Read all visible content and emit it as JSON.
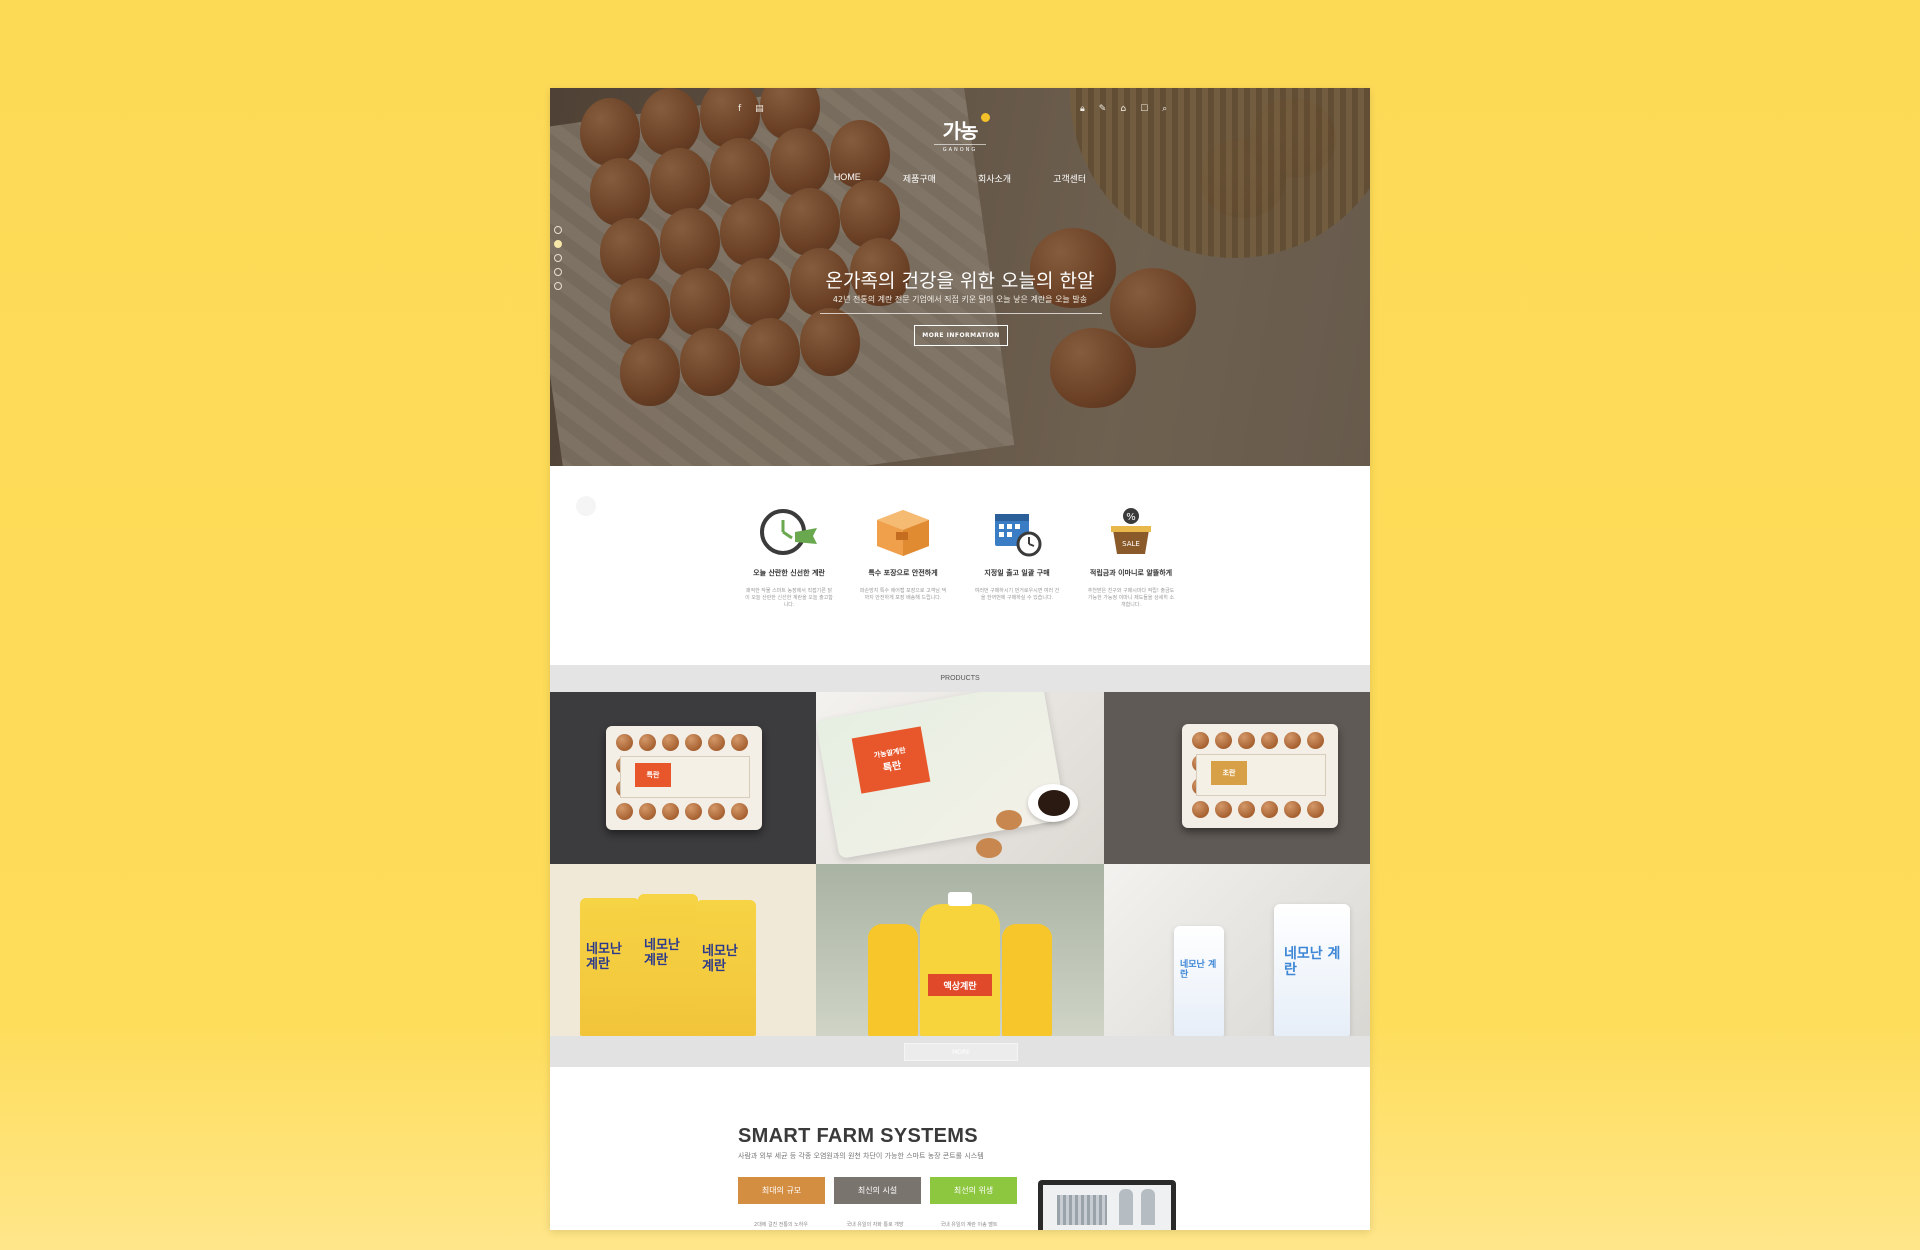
{
  "hero": {
    "social": [
      "f",
      "▤"
    ],
    "utilities": [
      {
        "icon": "lock-icon",
        "glyph": "🔒︎"
      },
      {
        "icon": "pen-icon",
        "glyph": "✎"
      },
      {
        "icon": "basket-icon",
        "glyph": "⌂"
      },
      {
        "icon": "chat-icon",
        "glyph": "☐"
      },
      {
        "icon": "search-icon",
        "glyph": "⌕"
      }
    ],
    "logo_text": "가농",
    "logo_sub": "GANONG",
    "nav": [
      "HOME",
      "제품구매",
      "회사소개",
      "고객센터"
    ],
    "title": "온가족의 건강을 위한 오늘의 한알",
    "subtitle": "42년 전통의 계란 전문 기업에서 직접 키운 닭이 오늘 낳은 계란을 오늘 발송",
    "button": "MORE INFORMATION"
  },
  "features": [
    {
      "title": "오늘 산란한 신선한 계란",
      "desc": "쾌적한 작물 스마트 농장에서 직접기른 닭이 오늘 산란한 신선한 계란을 오늘 출고합니다.",
      "icon": "clock-24-icon",
      "badge": "24h"
    },
    {
      "title": "특수 포장으로 안전하게",
      "desc": "파손방지 특수 에어캡 포장으로 고객님 댁까지 안전하게 포장 배송해 드립니다.",
      "icon": "box-icon"
    },
    {
      "title": "지정일 출고 일괄 구매",
      "desc": "여러번 구매하시기 번거로우시면 여러 건을 한꺼번에 구매하실 수 있습니다.",
      "icon": "calendar-icon"
    },
    {
      "title": "적립금과 이마니로 알뜰하게",
      "desc": "추천받은 친구와 구매시마다 적립! 출금도 가능한 가능정 이마니 제도들을 상세히 소개합니다.",
      "icon": "sale-basket-icon",
      "badge": "SALE"
    }
  ],
  "products": {
    "title": "PRODUCTS",
    "more_label": "MORE",
    "items": [
      "egg-carton-dark",
      "egg-pack-special",
      "egg-carton-gray",
      "carton-yellow",
      "liquid-egg-bottles",
      "carton-blue"
    ],
    "pack_labels": {
      "special": "특란",
      "brand": "가농알계란",
      "first": "초란",
      "carton_yellow": "네모난 계란",
      "bottle": "액상계란",
      "carton_blue": "네모난 계란"
    }
  },
  "smartfarm": {
    "title": "SMART FARM SYSTEMS",
    "subtitle": "사람과 외부 세균 등 각종 오염원과의 원천 차단이 가능한 스마트 농장 콘트롤 시스템",
    "buttons": [
      {
        "label": "최대의 규모",
        "color": "#D48E42"
      },
      {
        "label": "최신의 시설",
        "color": "#7A746E"
      },
      {
        "label": "최선의 위생",
        "color": "#8DC63F"
      }
    ],
    "columns": [
      "2대에 걸친 전통의 노하우",
      "국내 유일의 자화 통로 개방",
      "국내 유일의 계란 이송 벨트"
    ]
  },
  "colors": {
    "background": "#FDDA56",
    "accent_orange": "#D48E42",
    "accent_gray": "#7A746E",
    "accent_green": "#8DC63F"
  }
}
